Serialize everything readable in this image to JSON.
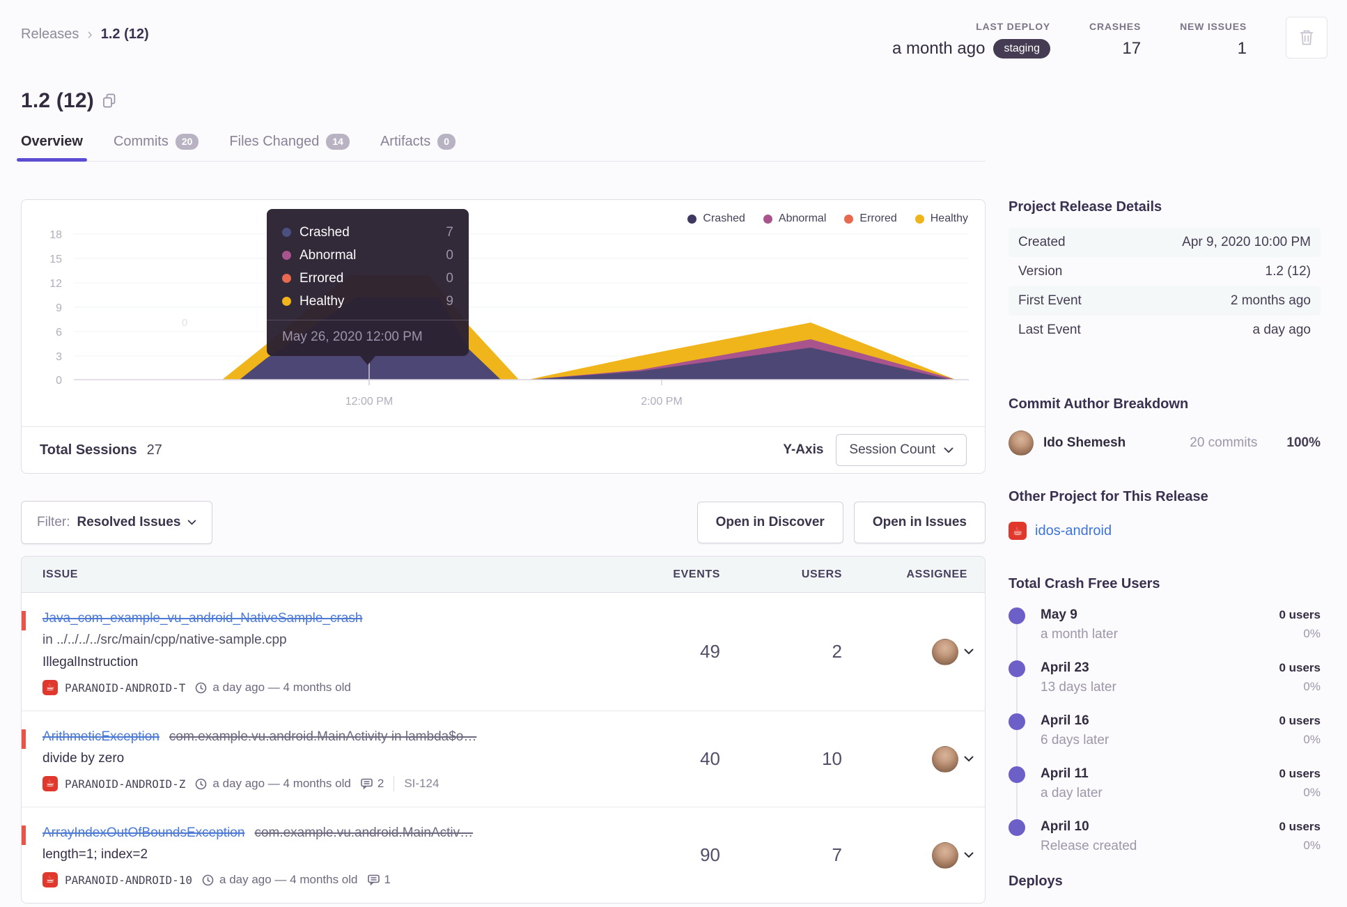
{
  "breadcrumb": {
    "root": "Releases",
    "current": "1.2 (12)"
  },
  "header_stats": {
    "last_deploy": {
      "label": "LAST DEPLOY",
      "value": "a month ago",
      "badge": "staging"
    },
    "crashes": {
      "label": "CRASHES",
      "value": "17"
    },
    "new_issues": {
      "label": "NEW ISSUES",
      "value": "1"
    }
  },
  "page_title": "1.2 (12)",
  "tabs": [
    {
      "label": "Overview",
      "badge": ""
    },
    {
      "label": "Commits",
      "badge": "20"
    },
    {
      "label": "Files Changed",
      "badge": "14"
    },
    {
      "label": "Artifacts",
      "badge": "0"
    }
  ],
  "chart": {
    "legend": [
      {
        "label": "Crashed",
        "color": "#3E3862"
      },
      {
        "label": "Abnormal",
        "color": "#A9548C"
      },
      {
        "label": "Errored",
        "color": "#E7694F"
      },
      {
        "label": "Healthy",
        "color": "#F0B51A"
      }
    ],
    "tooltip": {
      "rows": [
        {
          "label": "Crashed",
          "value": "7",
          "color": "#4A5080"
        },
        {
          "label": "Abnormal",
          "value": "0",
          "color": "#A9548C"
        },
        {
          "label": "Errored",
          "value": "0",
          "color": "#E7694F"
        },
        {
          "label": "Healthy",
          "value": "9",
          "color": "#F0B51A"
        }
      ],
      "date": "May 26, 2020 12:00 PM"
    },
    "y_ticks": [
      "18",
      "15",
      "12",
      "9",
      "6",
      "3",
      "0"
    ],
    "x_ticks": [
      "12:00 PM",
      "2:00 PM"
    ],
    "stray_label": "0"
  },
  "chart_data": {
    "type": "area",
    "stacked": true,
    "ylabel": "Session Count",
    "ylim": [
      0,
      18
    ],
    "y_ticks": [
      0,
      3,
      6,
      9,
      12,
      15,
      18
    ],
    "x_ticks": [
      "12:00 PM",
      "2:00 PM"
    ],
    "legend_position": "top-right",
    "series": [
      {
        "name": "Crashed",
        "color": "#4D4775",
        "points_approx": [
          [
            "11:15 AM",
            0
          ],
          [
            "12:00 PM",
            7
          ],
          [
            "1:15 PM",
            0
          ],
          [
            "2:30 PM",
            4
          ],
          [
            "3:30 PM",
            0
          ]
        ]
      },
      {
        "name": "Abnormal",
        "color": "#A9548C",
        "points_approx": [
          [
            "11:15 AM",
            0
          ],
          [
            "12:00 PM",
            0
          ],
          [
            "1:15 PM",
            0
          ],
          [
            "2:30 PM",
            1
          ],
          [
            "3:30 PM",
            0
          ]
        ]
      },
      {
        "name": "Errored",
        "color": "#E7694F",
        "points_approx": [
          [
            "11:15 AM",
            0
          ],
          [
            "12:00 PM",
            0
          ],
          [
            "1:15 PM",
            0
          ],
          [
            "2:30 PM",
            0
          ],
          [
            "3:30 PM",
            0
          ]
        ]
      },
      {
        "name": "Healthy",
        "color": "#F0B51A",
        "points_approx": [
          [
            "11:15 AM",
            0
          ],
          [
            "12:00 PM",
            9
          ],
          [
            "1:15 PM",
            0
          ],
          [
            "2:30 PM",
            2
          ],
          [
            "3:30 PM",
            0
          ]
        ]
      }
    ],
    "hovered_point": {
      "date": "May 26, 2020 12:00 PM",
      "Crashed": 7,
      "Abnormal": 0,
      "Errored": 0,
      "Healthy": 9
    },
    "total_sessions": 27
  },
  "chart_footer": {
    "total_sessions_label": "Total Sessions",
    "total_sessions_value": "27",
    "y_axis_label": "Y-Axis",
    "y_axis_value": "Session Count"
  },
  "filter_bar": {
    "filter_prefix": "Filter:",
    "filter_value": "Resolved Issues",
    "discover_button": "Open in Discover",
    "issues_button": "Open in Issues"
  },
  "issues": {
    "columns": {
      "issue": "ISSUE",
      "events": "EVENTS",
      "users": "USERS",
      "assignee": "ASSIGNEE"
    },
    "rows": [
      {
        "title": "Java_com_example_vu_android_NativeSample_crash",
        "culprit_inline": "",
        "culprit_block": "in ../../../../src/main/cpp/native-sample.cpp",
        "message": "IllegalInstruction",
        "project": "PARANOID-ANDROID-T",
        "age": "a day ago — 4 months old",
        "comments": "",
        "annotation": "",
        "events": "49",
        "users": "2"
      },
      {
        "title": "ArithmeticException",
        "culprit_inline": "com.example.vu.android.MainActivity in lambda$o…",
        "culprit_block": "",
        "message": "divide by zero",
        "project": "PARANOID-ANDROID-Z",
        "age": "a day ago — 4 months old",
        "comments": "2",
        "annotation": "SI-124",
        "events": "40",
        "users": "10"
      },
      {
        "title": "ArrayIndexOutOfBoundsException",
        "culprit_inline": "com.example.vu.android.MainActiv…",
        "culprit_block": "",
        "message": "length=1; index=2",
        "project": "PARANOID-ANDROID-10",
        "age": "a day ago — 4 months old",
        "comments": "1",
        "annotation": "",
        "events": "90",
        "users": "7"
      }
    ]
  },
  "sidebar": {
    "details": {
      "heading": "Project Release Details",
      "rows": [
        {
          "label": "Created",
          "value": "Apr 9, 2020 10:00 PM"
        },
        {
          "label": "Version",
          "value": "1.2 (12)"
        },
        {
          "label": "First Event",
          "value": "2 months ago"
        },
        {
          "label": "Last Event",
          "value": "a day ago"
        }
      ]
    },
    "commit_breakdown": {
      "heading": "Commit Author Breakdown",
      "author": {
        "name": "Ido Shemesh",
        "commits": "20 commits",
        "percent": "100%"
      }
    },
    "other_project": {
      "heading": "Other Project for This Release",
      "project": "idos-android"
    },
    "crash_free": {
      "heading": "Total Crash Free Users",
      "entries": [
        {
          "date": "May 9",
          "sub": "a month later",
          "users": "0 users",
          "percent": "0%"
        },
        {
          "date": "April 23",
          "sub": "13 days later",
          "users": "0 users",
          "percent": "0%"
        },
        {
          "date": "April 16",
          "sub": "6 days later",
          "users": "0 users",
          "percent": "0%"
        },
        {
          "date": "April 11",
          "sub": "a day later",
          "users": "0 users",
          "percent": "0%"
        },
        {
          "date": "April 10",
          "sub": "Release created",
          "users": "0 users",
          "percent": "0%"
        }
      ]
    },
    "deploys_heading": "Deploys"
  },
  "colors": {
    "accent_purple": "#6C5FC7",
    "tab_underline": "#5B4CD3",
    "link_blue": "#3D74DB",
    "issue_title_blue": "#4C7AD6",
    "alert_red": "#EE5244",
    "java_icon_red": "#E0382C",
    "tooltip_bg": "#2B2233",
    "staging_badge_bg": "#453C54",
    "series_crashed": "#4D4775",
    "series_abnormal": "#A9548C",
    "series_errored": "#E7694F",
    "series_healthy": "#F0B51A"
  },
  "icons": {
    "java_project_glyph": "☕"
  }
}
